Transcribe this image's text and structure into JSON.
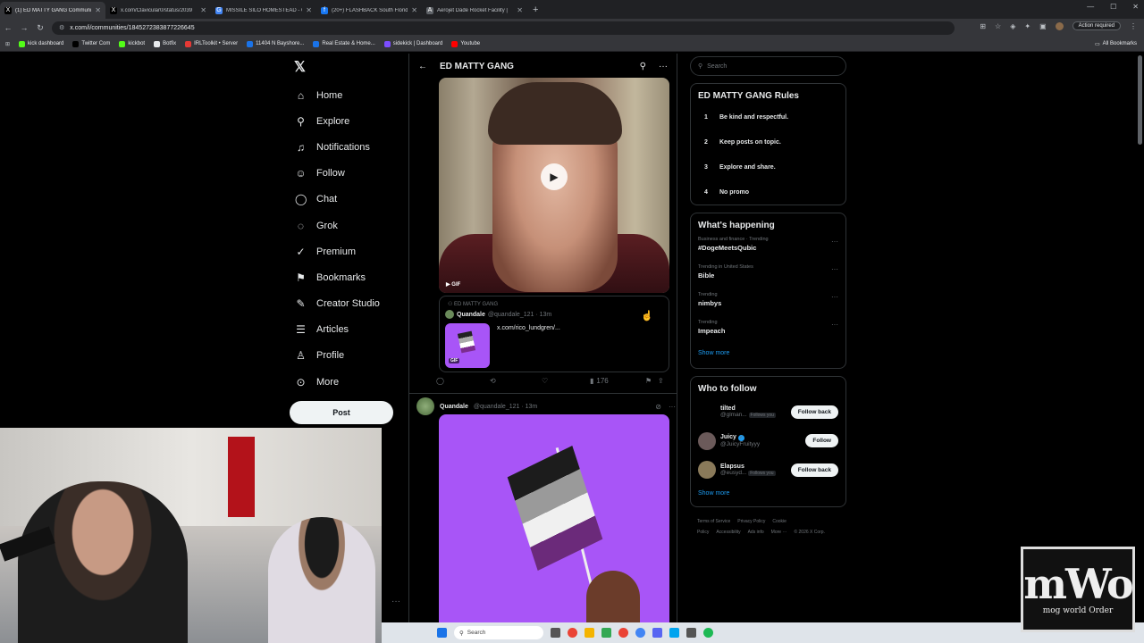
{
  "browser": {
    "tabs": [
      {
        "title": "(1) ED MATTY GANG Communi",
        "favicon": "X",
        "color": "#000000",
        "active": true
      },
      {
        "title": "x.com/Clavicular0/status/2039",
        "favicon": "X",
        "color": "#000000",
        "active": false
      },
      {
        "title": "MISSILE SILO HOMESTEAD - G",
        "favicon": "G",
        "color": "#4285f4",
        "active": false
      },
      {
        "title": "(20+) FLASHBACK South Florid",
        "favicon": "f",
        "color": "#1877f2",
        "active": false
      },
      {
        "title": "Aerojet Dade Rocket Facility |",
        "favicon": "A",
        "color": "#5f6368",
        "active": false
      }
    ],
    "url": "x.com/i/communities/1845272383877226645",
    "action_required": "Action required",
    "bookmarks": [
      {
        "label": "kick dashboard",
        "color": "#53fc18"
      },
      {
        "label": "Twitter Com",
        "color": "#000000"
      },
      {
        "label": "kickbot",
        "color": "#53fc18"
      },
      {
        "label": "Botfix",
        "color": "#e8eaed"
      },
      {
        "label": "IRLToolkit • Server",
        "color": "#e53935"
      },
      {
        "label": "11404 N Bayshore...",
        "color": "#1a73e8"
      },
      {
        "label": "Real Estate & Home...",
        "color": "#1a73e8"
      },
      {
        "label": "sidekick | Dashboard",
        "color": "#7c4dff"
      },
      {
        "label": "Youtube",
        "color": "#ff0000"
      }
    ],
    "all_bookmarks": "All Bookmarks"
  },
  "nav": {
    "items": [
      {
        "label": "Home",
        "icon": "home-icon",
        "glyph": "⌂"
      },
      {
        "label": "Explore",
        "icon": "search-icon",
        "glyph": "⚲"
      },
      {
        "label": "Notifications",
        "icon": "bell-icon",
        "glyph": "♫"
      },
      {
        "label": "Follow",
        "icon": "follow-icon",
        "glyph": "☺"
      },
      {
        "label": "Chat",
        "icon": "chat-icon",
        "glyph": "◯"
      },
      {
        "label": "Grok",
        "icon": "grok-icon",
        "glyph": "◌"
      },
      {
        "label": "Premium",
        "icon": "premium-icon",
        "glyph": "✓"
      },
      {
        "label": "Bookmarks",
        "icon": "bookmark-icon",
        "glyph": "⚑"
      },
      {
        "label": "Creator Studio",
        "icon": "creator-icon",
        "glyph": "✎"
      },
      {
        "label": "Articles",
        "icon": "articles-icon",
        "glyph": "☰"
      },
      {
        "label": "Profile",
        "icon": "profile-icon",
        "glyph": "♙"
      },
      {
        "label": "More",
        "icon": "more-icon",
        "glyph": "⊙"
      }
    ],
    "post_label": "Post"
  },
  "center": {
    "title": "ED MATTY GANG",
    "gif_label": "GIF",
    "quote": {
      "community": "ED MATTY GANG",
      "name": "Quandale",
      "handle_time": "@quandale_121 · 13m",
      "gif_badge": "GIF",
      "link": "x.com/rico_lundgren/..."
    },
    "stats": {
      "views": "176"
    },
    "post2": {
      "name": "Quandale",
      "handle_time": "@quandale_121 · 13m"
    }
  },
  "sidebar": {
    "search_placeholder": "Search",
    "rules_title": "ED MATTY GANG Rules",
    "rules": [
      {
        "n": "1",
        "text": "Be kind and respectful."
      },
      {
        "n": "2",
        "text": "Keep posts on topic."
      },
      {
        "n": "3",
        "text": "Explore and share."
      },
      {
        "n": "4",
        "text": "No promo"
      }
    ],
    "happening_title": "What's happening",
    "trends": [
      {
        "context": "Business and finance · Trending",
        "topic": "#DogeMeetsQubic"
      },
      {
        "context": "Trending in United States",
        "topic": "Bible"
      },
      {
        "context": "Trending",
        "topic": "nimbys"
      },
      {
        "context": "Trending",
        "topic": "Impeach"
      }
    ],
    "show_more": "Show more",
    "wtf_title": "Who to follow",
    "wtf": [
      {
        "name": "tilted",
        "handle": "@glman...",
        "follows_you": "Follows you",
        "button": "Follow back",
        "color": "#000000",
        "verified": false
      },
      {
        "name": "Juicy",
        "handle": "@JuicyFruityyy",
        "follows_you": "",
        "button": "Follow",
        "color": "#6b5a5a",
        "verified": true
      },
      {
        "name": "Elapsus",
        "handle": "@eusyd...",
        "follows_you": "Follows you",
        "button": "Follow back",
        "color": "#8a7a5a",
        "verified": false
      }
    ],
    "wtf_show_more": "Show more",
    "footer": [
      "Terms of Service",
      "Privacy Policy",
      "Cookie Policy",
      "Accessibility",
      "Ads info",
      "More ···",
      "© 2026 X Corp."
    ]
  },
  "taskbar": {
    "search": "Search"
  },
  "overlay": {
    "logo_big": "mWo",
    "logo_small": "mog world Order"
  }
}
